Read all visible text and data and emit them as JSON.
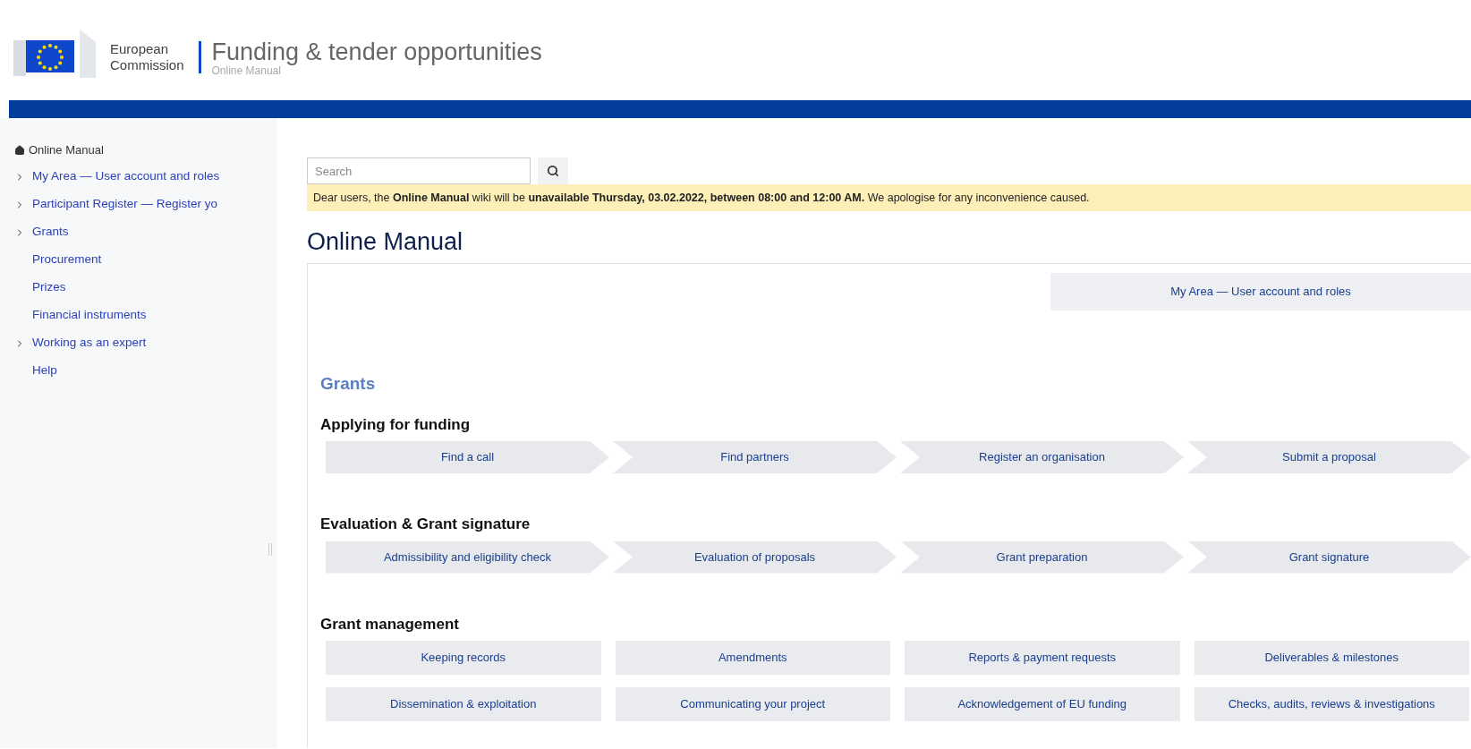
{
  "header": {
    "org_line1": "European",
    "org_line2": "Commission",
    "title": "Funding & tender opportunities",
    "subtitle": "Online Manual"
  },
  "sidebar": {
    "home": "Online Manual",
    "items": [
      {
        "label": "My Area — User account and roles",
        "expandable": true
      },
      {
        "label": "Participant Register — Register yo",
        "expandable": true
      },
      {
        "label": "Grants",
        "expandable": true
      },
      {
        "label": "Procurement",
        "expandable": false
      },
      {
        "label": "Prizes",
        "expandable": false
      },
      {
        "label": "Financial instruments",
        "expandable": false
      },
      {
        "label": "Working as an expert",
        "expandable": true
      },
      {
        "label": "Help",
        "expandable": false
      }
    ]
  },
  "search": {
    "placeholder": "Search"
  },
  "notice": "Dear users, the **Online Manual** wiki will be **unavailable Thursday, 03.02.2022, between 08:00 and 12:00 AM.** We apologise for any inconvenience caused.",
  "page_title": "Online Manual",
  "card": {
    "top_link": "My Area — User account and roles",
    "section_title": "Grants",
    "groups": [
      {
        "title": "Applying for funding",
        "kind": "chevrons",
        "steps": [
          "Find a call",
          "Find partners",
          "Register an organisation",
          "Submit a proposal"
        ]
      },
      {
        "title": "Evaluation & Grant signature",
        "kind": "chevrons",
        "steps": [
          "Admissibility and eligibility check",
          "Evaluation of proposals",
          "Grant preparation",
          "Grant signature"
        ]
      },
      {
        "title": "Grant management",
        "kind": "tiles",
        "steps": [
          "Keeping records",
          "Amendments",
          "Reports & payment requests",
          "Deliverables & milestones",
          "Dissemination & exploitation",
          "Communicating your project",
          "Acknowledgement of EU funding",
          "Checks, audits, reviews & investigations"
        ]
      }
    ]
  }
}
